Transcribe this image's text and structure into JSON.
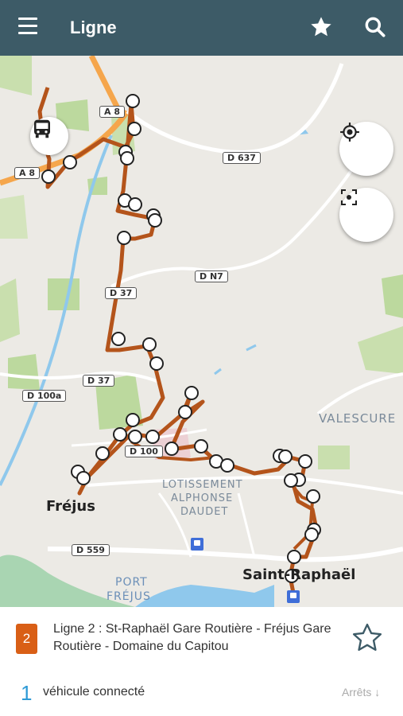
{
  "appbar": {
    "title": "Ligne",
    "background": "#3d5b67"
  },
  "map": {
    "road_labels": [
      "A 8",
      "A 8",
      "D 637",
      "D N7",
      "D 37",
      "D 37",
      "D 100a",
      "D 100",
      "D 559"
    ],
    "places": {
      "valescure": "VALESCURE",
      "lotissement_1": "LOTISSEMENT",
      "lotissement_2": "ALPHONSE",
      "lotissement_3": "DAUDET",
      "port_1": "PORT",
      "port_2": "FRÉJUS",
      "frejus": "Fréjus",
      "saint_raphael": "Saint-Raphaël"
    },
    "route_color": "#b4541b"
  },
  "line": {
    "number": "2",
    "name": "Ligne 2 : St-Raphaël Gare Routière - Fréjus Gare Routière - Domaine du Capitou",
    "badge_color": "#d95f16"
  },
  "vehicles": {
    "count": "1",
    "label": "véhicule connecté"
  },
  "stops_button": "Arrêts ↓",
  "icons": [
    "menu-icon",
    "star-icon",
    "search-icon",
    "my-location-icon",
    "fit-route-icon",
    "bus-icon",
    "star-outline-icon",
    "train-station-icon"
  ]
}
